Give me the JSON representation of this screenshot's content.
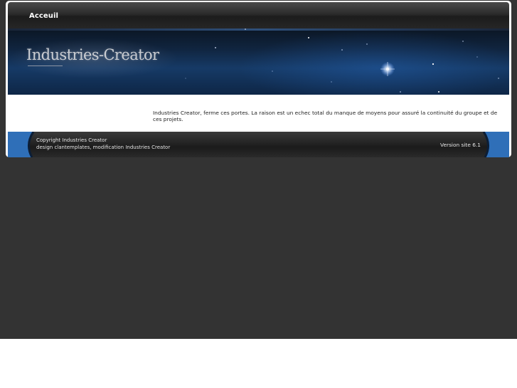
{
  "nav": {
    "items": [
      {
        "label": "Acceuil"
      }
    ]
  },
  "banner": {
    "logo_text": "Industries-Creator"
  },
  "content": {
    "text": "Industries Creator, ferme ces portes. La raison est un echec total du manque de moyens pour assuré la continuité du groupe et de ces projets."
  },
  "footer": {
    "copyright_line1": "Copyright Industries Creator",
    "copyright_line2": "design clantemplates, modification Industries Creator",
    "version": "Version site 6.1"
  },
  "colors": {
    "page_background": "#333333",
    "header_dark": "#1c1c1c",
    "banner_blue": "#163a66",
    "footer_accent_blue": "#2f6fb8"
  }
}
